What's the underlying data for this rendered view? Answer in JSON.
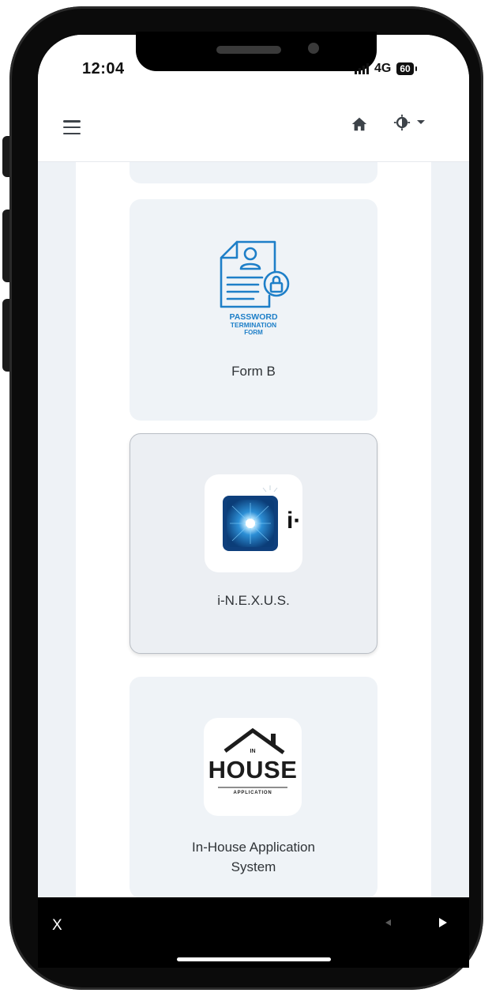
{
  "status_bar": {
    "time": "12:04",
    "network": "4G",
    "battery": "60"
  },
  "navbar": {
    "menu_icon": "hamburger-icon",
    "home_icon": "home-icon",
    "theme_icon": "contrast-icon",
    "theme_caret_icon": "caret-down-icon"
  },
  "cards": [
    {
      "logo_lines": [
        "PASSWORD",
        "TERMINATION",
        "FORM"
      ],
      "label": "Form B"
    },
    {
      "logo_text": "i·",
      "label": "i-N.E.X.U.S."
    },
    {
      "logo_small_text": "IN",
      "logo_main_text": "HOUSE",
      "logo_sub_text": "APPLICATION",
      "label_line1": "In-House Application",
      "label_line2": "System"
    }
  ],
  "browser_bar": {
    "close_label": "X"
  },
  "colors": {
    "card_bg": "#eff3f7",
    "page_bg": "#eef2f6",
    "form_icon_blue": "#1e7fc8",
    "nexus_blue": "#1d6fb8",
    "text": "#2f3337"
  }
}
